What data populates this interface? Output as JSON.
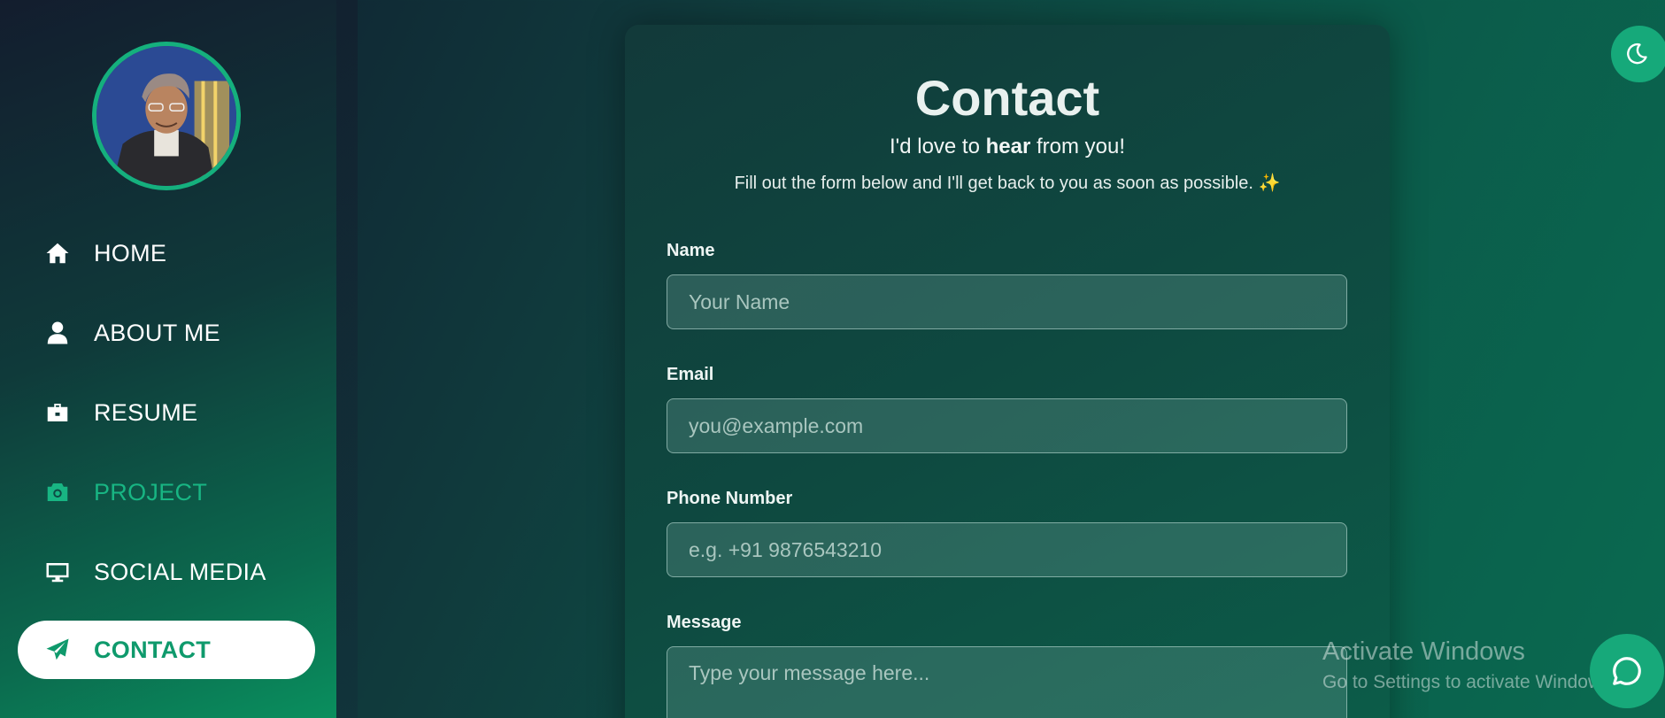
{
  "sidebar": {
    "items": [
      {
        "label": "HOME",
        "icon": "home-icon"
      },
      {
        "label": "ABOUT ME",
        "icon": "user-icon"
      },
      {
        "label": "RESUME",
        "icon": "briefcase-icon"
      },
      {
        "label": "PROJECT",
        "icon": "camera-icon"
      },
      {
        "label": "SOCIAL MEDIA",
        "icon": "monitor-icon"
      },
      {
        "label": "CONTACT",
        "icon": "paper-plane-icon"
      }
    ],
    "active_item": "CONTACT",
    "hover_item": "PROJECT"
  },
  "contact": {
    "title": "Contact",
    "subtitle_pre": "I'd love to ",
    "subtitle_bold": "hear",
    "subtitle_post": " from you!",
    "subtext": "Fill out the form below and I'll get back to you as soon as possible. ✨",
    "fields": {
      "name": {
        "label": "Name",
        "placeholder": "Your Name"
      },
      "email": {
        "label": "Email",
        "placeholder": "you@example.com"
      },
      "phone": {
        "label": "Phone Number",
        "placeholder": "e.g. +91 9876543210"
      },
      "message": {
        "label": "Message",
        "placeholder": "Type your message here..."
      }
    }
  },
  "watermark": {
    "title": "Activate Windows",
    "subtitle": "Go to Settings to activate Windows."
  },
  "colors": {
    "accent": "#16a97a",
    "active_text": "#0f9a6c",
    "hover_text": "#18b583"
  },
  "floating": {
    "theme_toggle_icon": "moon-icon",
    "chat_icon": "chat-bubble-icon"
  }
}
